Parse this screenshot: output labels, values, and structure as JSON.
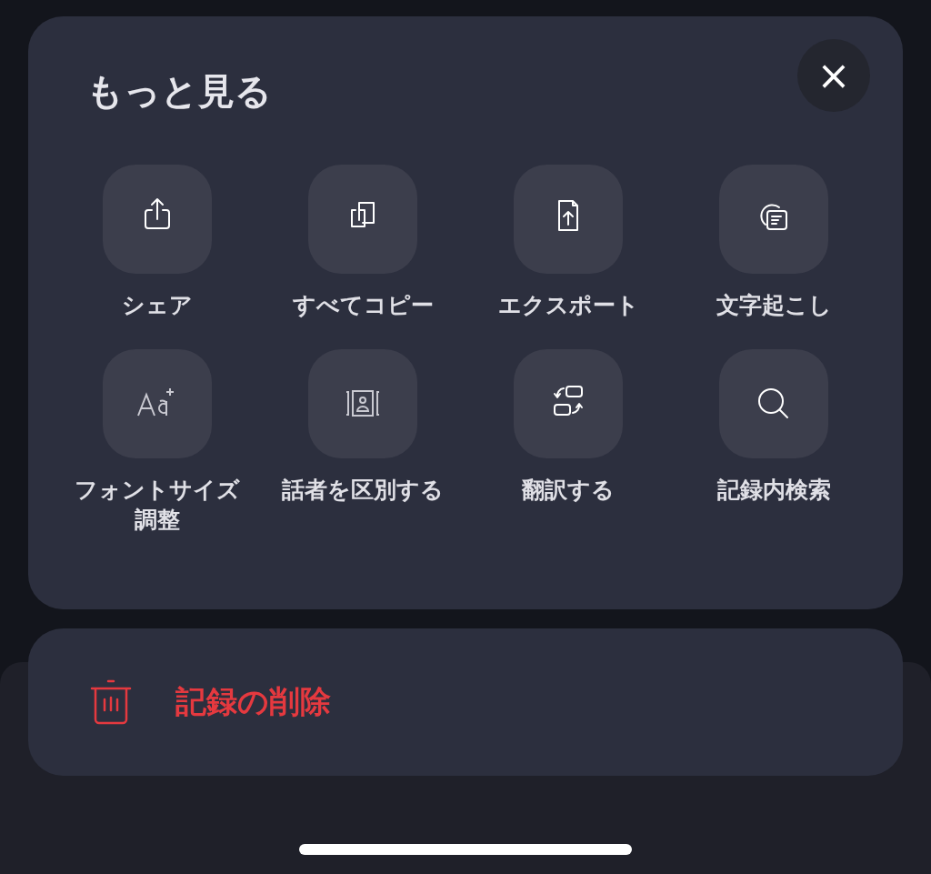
{
  "sheet": {
    "title": "もっと見る",
    "close": "×"
  },
  "actions": [
    {
      "kind": "share",
      "label": "シェア"
    },
    {
      "kind": "copy",
      "label": "すべてコピー"
    },
    {
      "kind": "export",
      "label": "エクスポート"
    },
    {
      "kind": "transcript",
      "label": "文字起こし"
    },
    {
      "kind": "font",
      "label": "フォントサイズ調整"
    },
    {
      "kind": "speaker",
      "label": "話者を区別する"
    },
    {
      "kind": "translate",
      "label": "翻訳する"
    },
    {
      "kind": "search",
      "label": "記録内検索"
    }
  ],
  "delete": {
    "label": "記録の削除"
  }
}
